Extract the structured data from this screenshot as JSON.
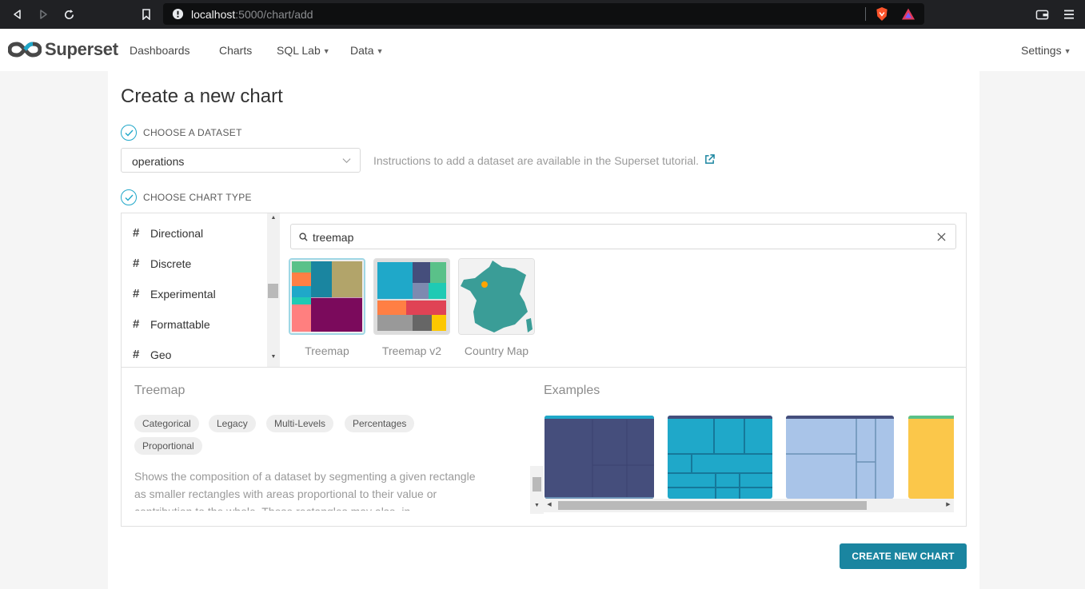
{
  "browser": {
    "url_host": "localhost",
    "url_path": ":5000/chart/add"
  },
  "navbar": {
    "brand": "Superset",
    "items": [
      {
        "label": "Dashboards"
      },
      {
        "label": "Charts"
      },
      {
        "label": "SQL Lab"
      },
      {
        "label": "Data"
      }
    ],
    "settings_label": "Settings"
  },
  "page": {
    "title": "Create a new chart",
    "dataset_step_label": "CHOOSE A DATASET",
    "dataset_value": "operations",
    "dataset_instructions": "Instructions to add a dataset are available in the Superset tutorial.",
    "chart_type_step_label": "CHOOSE CHART TYPE",
    "create_button_label": "CREATE NEW CHART"
  },
  "categories": [
    {
      "label": "Directional"
    },
    {
      "label": "Discrete"
    },
    {
      "label": "Experimental"
    },
    {
      "label": "Formattable"
    },
    {
      "label": "Geo"
    }
  ],
  "search": {
    "value": "treemap"
  },
  "results": [
    {
      "label": "Treemap",
      "selected": true
    },
    {
      "label": "Treemap v2",
      "selected": false
    },
    {
      "label": "Country Map",
      "selected": false
    }
  ],
  "detail": {
    "title": "Treemap",
    "tags": [
      "Categorical",
      "Legacy",
      "Multi-Levels",
      "Percentages",
      "Proportional"
    ],
    "description": "Shows the composition of a dataset by segmenting a given rectangle as smaller rectangles with areas proportional to their value or contribution to the whole. Those rectangles may also, in",
    "examples_title": "Examples"
  },
  "colors": {
    "accent": "#20a7c9",
    "button": "#1a85a0"
  }
}
